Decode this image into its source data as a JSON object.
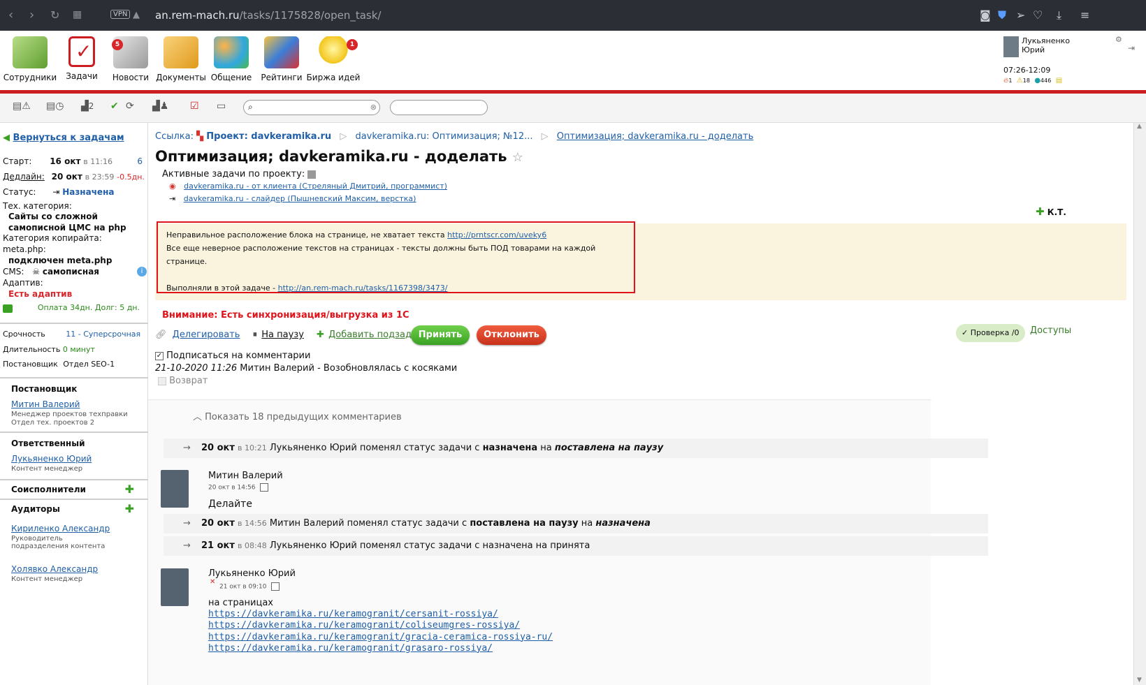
{
  "browser": {
    "vpn_label": "VPN",
    "url_host": "an.rem-mach.ru",
    "url_path": "/tasks/1175828/open_task/"
  },
  "menu": {
    "items": [
      {
        "label": "Сотрудники",
        "icon": "employees-icon"
      },
      {
        "label": "Задачи",
        "icon": "tasks-icon"
      },
      {
        "label": "Новости",
        "icon": "news-icon",
        "badge": "5"
      },
      {
        "label": "Документы",
        "icon": "documents-icon"
      },
      {
        "label": "Общение",
        "icon": "chat-icon"
      },
      {
        "label": "Рейтинги",
        "icon": "ratings-icon"
      },
      {
        "label": "Биржа идей",
        "icon": "ideas-icon",
        "badge": "1"
      }
    ]
  },
  "user": {
    "name": "Лукьяненко Юрий",
    "time": "07:26-12:09",
    "stat1": "1",
    "stat2": "18",
    "stat3": "446"
  },
  "toolbar": {
    "counter": "2"
  },
  "sidebar": {
    "back_label": "Вернуться к задачам",
    "start_label": "Старт:",
    "start_date": "16 окт",
    "start_time": "в 11:16",
    "start_num": "6",
    "deadline_label": "Дедлайн:",
    "deadline_date": "20 окт",
    "deadline_time": "в 23:59",
    "deadline_delta": "-0.5дн.",
    "status_label": "Статус:",
    "status_value": "Назначена",
    "tech_category_label": "Тех. категория:",
    "tech_category_value": "Сайты со сложной самописной ЦМС на php",
    "copy_category_label": "Категория копирайта:",
    "meta_label": "meta.php:",
    "meta_value": "подключен meta.php",
    "cms_label": "CMS:",
    "cms_value": "самописная",
    "adaptive_label": "Адаптив:",
    "adaptive_value": "Есть адаптив",
    "payment": "Оплата 34дн. Долг: 5 дн.",
    "urgency_label": "Срочность",
    "urgency_value": "11 - Суперсрочная",
    "duration_label": "Длительность",
    "duration_value": "0 минут",
    "setter_label": "Постановщик",
    "setter_value": "Отдел SEO-1",
    "sec_setter": "Постановщик",
    "setter_name": "Митин Валерий",
    "setter_role": "Менеджер проектов техправки",
    "setter_dept": "Отдел тех. проектов 2",
    "sec_responsible": "Ответственный",
    "resp_name": "Лукьяненко Юрий",
    "resp_role": "Контент менеджер",
    "sec_coexec": "Соисполнители",
    "sec_auditors": "Аудиторы",
    "aud1_name": "Кириленко Александр",
    "aud1_role": "Руководитель подразделения контента",
    "aud2_name": "Холявко Александр",
    "aud2_role": "Контент менеджер"
  },
  "main": {
    "bc_link_label": "Ссылка:",
    "bc_project": "Проект: davkeramika.ru",
    "bc_parent": "davkeramika.ru: Оптимизация; №12...",
    "bc_current": "Оптимизация; davkeramika.ru - доделать",
    "title": "Оптимизация; davkeramika.ru - доделать",
    "active_tasks_label": "Активные задачи по проекту:",
    "active_task1": "davkeramika.ru - от клиента (Стреляный Дмитрий, программист)",
    "active_task2": "davkeramika.ru - слайдер (Пышневский Максим, верстка)",
    "kt_label": "К.Т.",
    "desc_line1": "Неправильное расположение блока на странице, не хватает текста",
    "desc_link1": "http://prntscr.com/uveky6",
    "desc_line2": "Все еще неверное расположение текстов на страницах - тексты должны быть ПОД товарами на каждой странице.",
    "desc_line3": "Выполняли в этой задаче -",
    "desc_link2": "http://an.rem-mach.ru/tasks/1167398/3473/",
    "warning": "Внимание: Есть синхронизация/выгрузка из 1С",
    "delegate_label": "Делегировать",
    "pause_label": "На паузу",
    "add_subtask_label": "Добавить подзадачу",
    "accept_label": "Принять",
    "reject_label": "Отклонить",
    "check_label": "Проверка",
    "check_count": "/0",
    "access_label": "Доступы",
    "subscribe_label": "Подписаться на комментарии",
    "last_event": "21-10-2020 11:26",
    "last_event_text": "Митин Валерий - Возобновлялась с косяками",
    "return_label": "Возврат",
    "show_prev": "Показать 18 предыдущих комментариев"
  },
  "feed": [
    {
      "date": "20 окт",
      "time": "в 10:21",
      "text": "Лукьяненко Юрий поменял статус задачи с",
      "from": "назначена",
      "mid": "на",
      "to": "поставлена на паузу"
    },
    {
      "date": "20 окт",
      "time": "в 14:56",
      "text": "Митин Валерий поменял статус задачи с",
      "from": "поставлена на паузу",
      "mid": "на",
      "to": "назначена"
    },
    {
      "date": "21 окт",
      "time": "в 08:48",
      "text": "Лукьяненко Юрий поменял статус задачи с назначена на принята"
    }
  ],
  "comment1": {
    "author": "Митин Валерий",
    "date": "20 окт в 14:56",
    "text": "Делайте"
  },
  "comment2": {
    "author": "Лукьяненко Юрий",
    "date": "21 окт в 09:10",
    "text": "на страницах",
    "links": [
      "https://davkeramika.ru/keramogranit/cersanit-rossiya/",
      "https://davkeramika.ru/keramogranit/coliseumgres-rossiya/",
      "https://davkeramika.ru/keramogranit/gracia-ceramica-rossiya-ru/",
      "https://davkeramika.ru/keramogranit/grasaro-rossiya/"
    ]
  }
}
